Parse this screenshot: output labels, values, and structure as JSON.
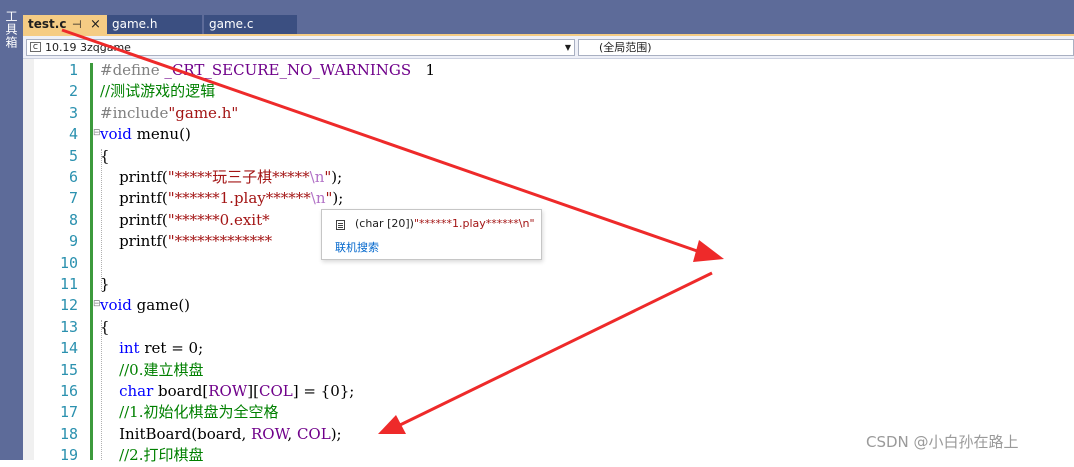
{
  "toolbox": {
    "label": "工具箱"
  },
  "tabs": [
    {
      "label": "test.c",
      "active": true
    },
    {
      "label": "game.h",
      "active": false
    },
    {
      "label": "game.c",
      "active": false
    }
  ],
  "tab_pin_glyph": "⊣",
  "tab_close_glyph": "×",
  "scope_bar": {
    "project": "10.19 3zqgame",
    "scope": "(全局范围)"
  },
  "tooltip": {
    "type_text": "(char [20])",
    "value_text": "\"******1.play******\\n\"",
    "link_text": "联机搜索"
  },
  "code_lines": [
    {
      "n": "1",
      "text": "#define _CRT_SECURE_NO_WARNINGS   1"
    },
    {
      "n": "2",
      "text": "//测试游戏的逻辑"
    },
    {
      "n": "3",
      "text": "#include\"game.h\""
    },
    {
      "n": "4",
      "text": "void menu()"
    },
    {
      "n": "5",
      "text": "{"
    },
    {
      "n": "6",
      "text": "    printf(\"*****玩三子棋*****\\n\");"
    },
    {
      "n": "7",
      "text": "    printf(\"******1.play******\\n\");"
    },
    {
      "n": "8",
      "text": "    printf(\"******0.exit*"
    },
    {
      "n": "9",
      "text": "    printf(\"*************"
    },
    {
      "n": "10",
      "text": ""
    },
    {
      "n": "11",
      "text": "}"
    },
    {
      "n": "12",
      "text": "void game()"
    },
    {
      "n": "13",
      "text": "{"
    },
    {
      "n": "14",
      "text": "    int ret = 0;"
    },
    {
      "n": "15",
      "text": "    //0.建立棋盘"
    },
    {
      "n": "16",
      "text": "    char board[ROW][COL] = {0};"
    },
    {
      "n": "17",
      "text": "    //1.初始化棋盘为全空格"
    },
    {
      "n": "18",
      "text": "    InitBoard(board, ROW, COL);"
    },
    {
      "n": "19",
      "text": "    //2.打印棋盘"
    }
  ],
  "watermark": "CSDN @小白孙在路上",
  "colors": {
    "frame": "#5d6b99",
    "active_tab": "#f5cc84",
    "keyword": "#0000ff",
    "comment": "#008000",
    "string": "#a31515",
    "macro": "#6f008a",
    "line_number": "#2b91af",
    "annotation_arrow": "#ee2a2a"
  }
}
